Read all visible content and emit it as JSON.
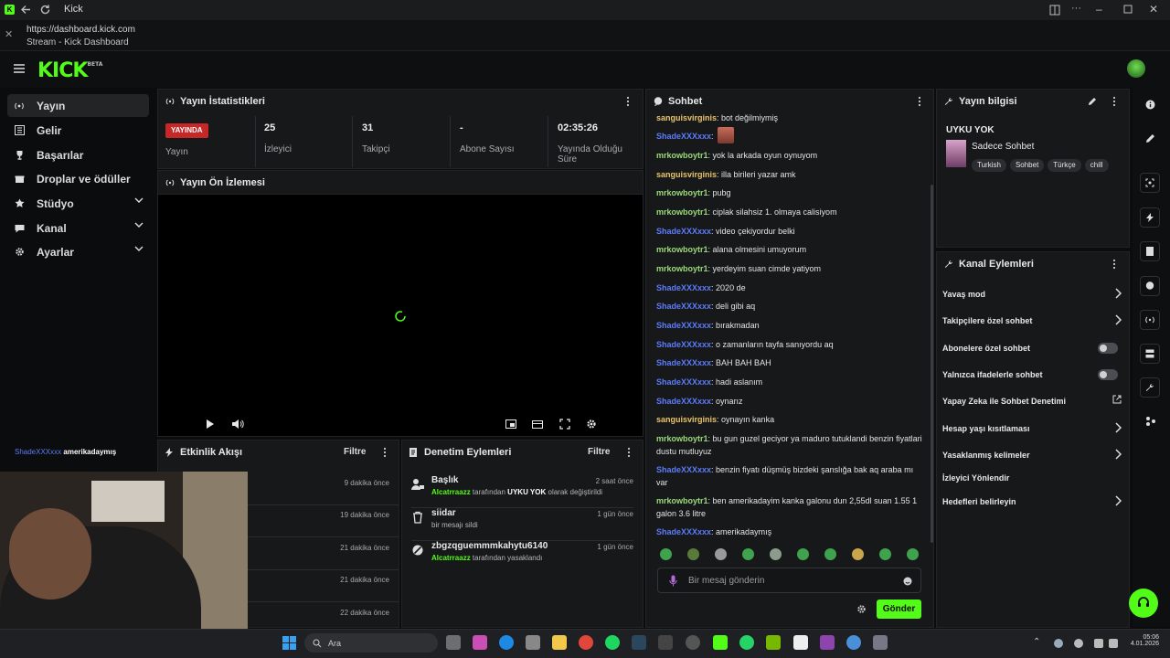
{
  "browser": {
    "tab_title": "Kick",
    "url": "https://dashboard.kick.com",
    "page_title": "Stream - Kick Dashboard"
  },
  "brand": {
    "logo": "KICK",
    "logo_sup": "BETA",
    "accent": "#53fc18"
  },
  "sidebar": {
    "items": [
      {
        "label": "Yayın",
        "icon": "broadcast-icon",
        "active": true
      },
      {
        "label": "Gelir",
        "icon": "revenue-icon"
      },
      {
        "label": "Başarılar",
        "icon": "trophy-icon"
      },
      {
        "label": "Droplar ve ödüller",
        "icon": "gift-icon"
      },
      {
        "label": "Stüdyo",
        "icon": "studio-icon",
        "expandable": true
      },
      {
        "label": "Kanal",
        "icon": "channel-icon",
        "expandable": true
      },
      {
        "label": "Ayarlar",
        "icon": "gear-icon",
        "expandable": true
      }
    ]
  },
  "stats": {
    "title": "Yayın İstatistikleri",
    "live_badge": "YAYINDA",
    "live_label": "Yayın",
    "viewers_value": "25",
    "viewers_label": "İzleyici",
    "followers_value": "31",
    "followers_label": "Takipçi",
    "subs_value": "-",
    "subs_label": "Abone Sayısı",
    "uptime_value": "02:35:26",
    "uptime_label_1": "Yayında Olduğu",
    "uptime_label_2": "Süre"
  },
  "preview": {
    "title": "Yayın Ön İzlemesi"
  },
  "overlay_chat": {
    "user": "ShadeXXXxxx",
    "message": "amerikadaymış"
  },
  "activity": {
    "title": "Etkinlik Akışı",
    "filter": "Filtre",
    "times": [
      "9 dakika önce",
      "19 dakika önce",
      "21 dakika önce",
      "21 dakika önce",
      "22 dakika önce"
    ]
  },
  "moderation": {
    "title": "Denetim Eylemleri",
    "filter": "Filtre",
    "items": [
      {
        "title": "Başlık",
        "actor": "Alcatrraazz",
        "mid": " tarafından ",
        "target": "UYKU YOK",
        "suffix": " olarak değiştirildi",
        "time": "2 saat önce"
      },
      {
        "title": "siidar",
        "line": "bir mesajı sildi",
        "time": "1 gün önce"
      },
      {
        "title": "zbgzqguemmmkahytu6140",
        "actor": "Alcatrraazz",
        "mid": " tarafından yasaklandı",
        "time": "1 gün önce"
      }
    ]
  },
  "chat": {
    "title": "Sohbet",
    "messages": [
      {
        "user": "sanguisvirginis",
        "color": "yellow",
        "text": ": bot değilmiymiş"
      },
      {
        "user": "ShadeXXXxxx",
        "color": "blue",
        "text": ":"
      },
      {
        "user": "mrkowboytr1",
        "color": "green",
        "text": ": yok la arkada oyun oynuyom"
      },
      {
        "user": "sanguisvirginis",
        "color": "yellow",
        "text": ": illa birileri yazar amk"
      },
      {
        "user": "mrkowboytr1",
        "color": "green",
        "text": ": pubg"
      },
      {
        "user": "mrkowboytr1",
        "color": "green",
        "text": ": ciplak silahsiz 1. olmaya calisiyom"
      },
      {
        "user": "ShadeXXXxxx",
        "color": "blue",
        "text": ": video çekiyordur belki"
      },
      {
        "user": "mrkowboytr1",
        "color": "green",
        "text": ": alana olmesini umuyorum"
      },
      {
        "user": "mrkowboytr1",
        "color": "green",
        "text": ": yerdeyim suan cimde yatiyom"
      },
      {
        "user": "ShadeXXXxxx",
        "color": "blue",
        "text": ": 2020 de"
      },
      {
        "user": "ShadeXXXxxx",
        "color": "blue",
        "text": ": deli gibi aq"
      },
      {
        "user": "ShadeXXXxxx",
        "color": "blue",
        "text": ": bırakmadan"
      },
      {
        "user": "ShadeXXXxxx",
        "color": "blue",
        "text": ": o zamanların tayfa sanıyordu aq"
      },
      {
        "user": "ShadeXXXxxx",
        "color": "blue",
        "text": ": BAH BAH BAH"
      },
      {
        "user": "ShadeXXXxxx",
        "color": "blue",
        "text": ": hadi aslanım"
      },
      {
        "user": "ShadeXXXxxx",
        "color": "blue",
        "text": ": oynarız"
      },
      {
        "user": "sanguisvirginis",
        "color": "yellow",
        "text": ": oynayın kanka"
      },
      {
        "user": "mrkowboytr1",
        "color": "green",
        "text": ": bu gun guzel geciyor ya maduro tutuklandi benzin fiyatlari dustu mutluyuz"
      },
      {
        "user": "ShadeXXXxxx",
        "color": "blue",
        "text": ": benzin fiyatı düşmüş bizdeki şanslığa bak aq araba mı var"
      },
      {
        "user": "mrkowboytr1",
        "color": "green",
        "text": ": ben amerikadayim kanka galonu dun 2,55dl suan 1.55 1 galon 3.6 litre"
      },
      {
        "user": "ShadeXXXxxx",
        "color": "blue",
        "text": ": amerikadaymış"
      }
    ],
    "input_placeholder": "Bir mesaj gönderin",
    "send_label": "Gönder"
  },
  "stream_info": {
    "title": "Yayın bilgisi",
    "stream_title": "UYKU YOK",
    "category": "Sadece Sohbet",
    "tags": [
      "Turkish",
      "Sohbet",
      "Türkçe",
      "chill"
    ]
  },
  "channel_actions": {
    "title": "Kanal Eylemleri",
    "items": [
      {
        "label": "Yavaş mod",
        "control": "chevron"
      },
      {
        "label": "Takipçilere özel sohbet",
        "control": "chevron"
      },
      {
        "label": "Abonelere özel sohbet",
        "control": "toggle"
      },
      {
        "label": "Yalnızca ifadelerle sohbet",
        "control": "toggle"
      },
      {
        "label": "Yapay Zeka ile Sohbet Denetimi",
        "control": "external"
      },
      {
        "label": "Hesap yaşı kısıtlaması",
        "control": "chevron"
      },
      {
        "label": "Yasaklanmış kelimeler",
        "control": "chevron"
      },
      {
        "label": "İzleyici Yönlendir",
        "control": "none"
      },
      {
        "label": "Hedefleri belirleyin",
        "control": "chevron"
      }
    ]
  },
  "taskbar": {
    "search": "Ara",
    "time": "05:06",
    "date": "4.01.2026"
  }
}
